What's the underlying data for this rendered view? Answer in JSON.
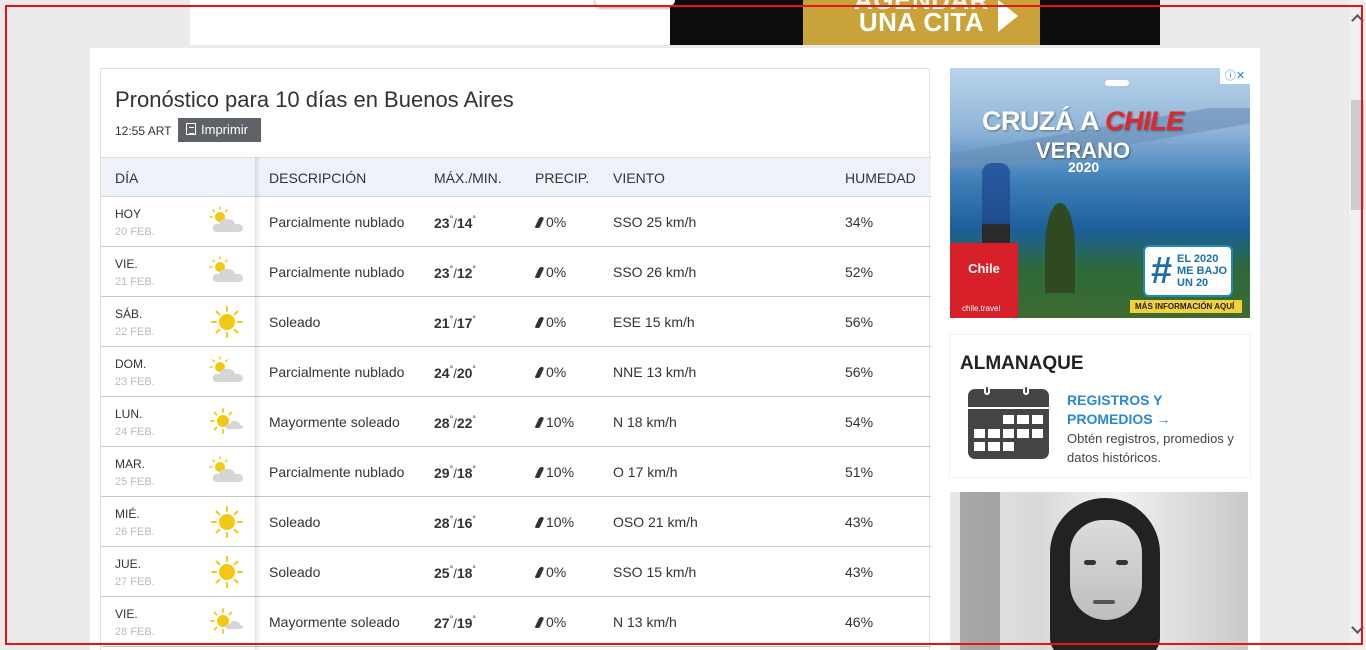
{
  "top_ad": {
    "cta": "UNA CITA",
    "cut_text": "AGENDAR"
  },
  "forecast": {
    "title": "Pronóstico para 10 días en Buenos Aires",
    "time": "12:55 ART",
    "print_label": "Imprimir",
    "headers": {
      "day": "DÍA",
      "description": "DESCRIPCIÓN",
      "maxmin": "MÁX./MIN.",
      "precip": "PRECIP.",
      "wind": "VIENTO",
      "humidity": "HUMEDAD"
    },
    "rows": [
      {
        "day": "HOY",
        "date": "20 FEB.",
        "icon": "partly-cloudy-icon",
        "description": "Parcialmente nublado",
        "max": "23",
        "min": "14",
        "precip": "0%",
        "wind": "SSO 25 km/h",
        "humidity": "34%"
      },
      {
        "day": "VIE.",
        "date": "21 FEB.",
        "icon": "partly-cloudy-icon",
        "description": "Parcialmente nublado",
        "max": "23",
        "min": "12",
        "precip": "0%",
        "wind": "SSO 26 km/h",
        "humidity": "52%"
      },
      {
        "day": "SÁB.",
        "date": "22 FEB.",
        "icon": "sunny-icon",
        "description": "Soleado",
        "max": "21",
        "min": "17",
        "precip": "0%",
        "wind": "ESE 15 km/h",
        "humidity": "56%"
      },
      {
        "day": "DOM.",
        "date": "23 FEB.",
        "icon": "partly-cloudy-icon",
        "description": "Parcialmente nublado",
        "max": "24",
        "min": "20",
        "precip": "0%",
        "wind": "NNE 13 km/h",
        "humidity": "56%"
      },
      {
        "day": "LUN.",
        "date": "24 FEB.",
        "icon": "mostly-sunny-icon",
        "description": "Mayormente soleado",
        "max": "28",
        "min": "22",
        "precip": "10%",
        "wind": "N 18 km/h",
        "humidity": "54%"
      },
      {
        "day": "MAR.",
        "date": "25 FEB.",
        "icon": "partly-cloudy-icon",
        "description": "Parcialmente nublado",
        "max": "29",
        "min": "18",
        "precip": "10%",
        "wind": "O 17 km/h",
        "humidity": "51%"
      },
      {
        "day": "MIÉ.",
        "date": "26 FEB.",
        "icon": "sunny-icon",
        "description": "Soleado",
        "max": "28",
        "min": "16",
        "precip": "10%",
        "wind": "OSO 21 km/h",
        "humidity": "43%"
      },
      {
        "day": "JUE.",
        "date": "27 FEB.",
        "icon": "sunny-icon",
        "description": "Soleado",
        "max": "25",
        "min": "18",
        "precip": "0%",
        "wind": "SSO 15 km/h",
        "humidity": "43%"
      },
      {
        "day": "VIE.",
        "date": "28 FEB.",
        "icon": "mostly-sunny-icon",
        "description": "Mayormente soleado",
        "max": "27",
        "min": "19",
        "precip": "0%",
        "wind": "N 13 km/h",
        "humidity": "46%"
      }
    ]
  },
  "side_ad": {
    "line1_a": "CRUZÁ A ",
    "line1_b": "CHILE",
    "line2": "VERANO",
    "line3": "2020",
    "brand": "Chile",
    "brand_url": "chile.travel",
    "badge": "EL 2020 ME BAJO UN 20",
    "badge_hash": "#",
    "more": "MÁS INFORMACIÓN AQUÍ"
  },
  "almanac": {
    "title": "ALMANAQUE",
    "link": "REGISTROS Y PROMEDIOS →",
    "subtitle": "Obtén registros, promedios y datos históricos."
  },
  "colors": {
    "accent_blue": "#2b87d3",
    "header_bg": "#edf3f9",
    "sun_yellow": "#f2c811",
    "frame_red": "#e0161b"
  }
}
